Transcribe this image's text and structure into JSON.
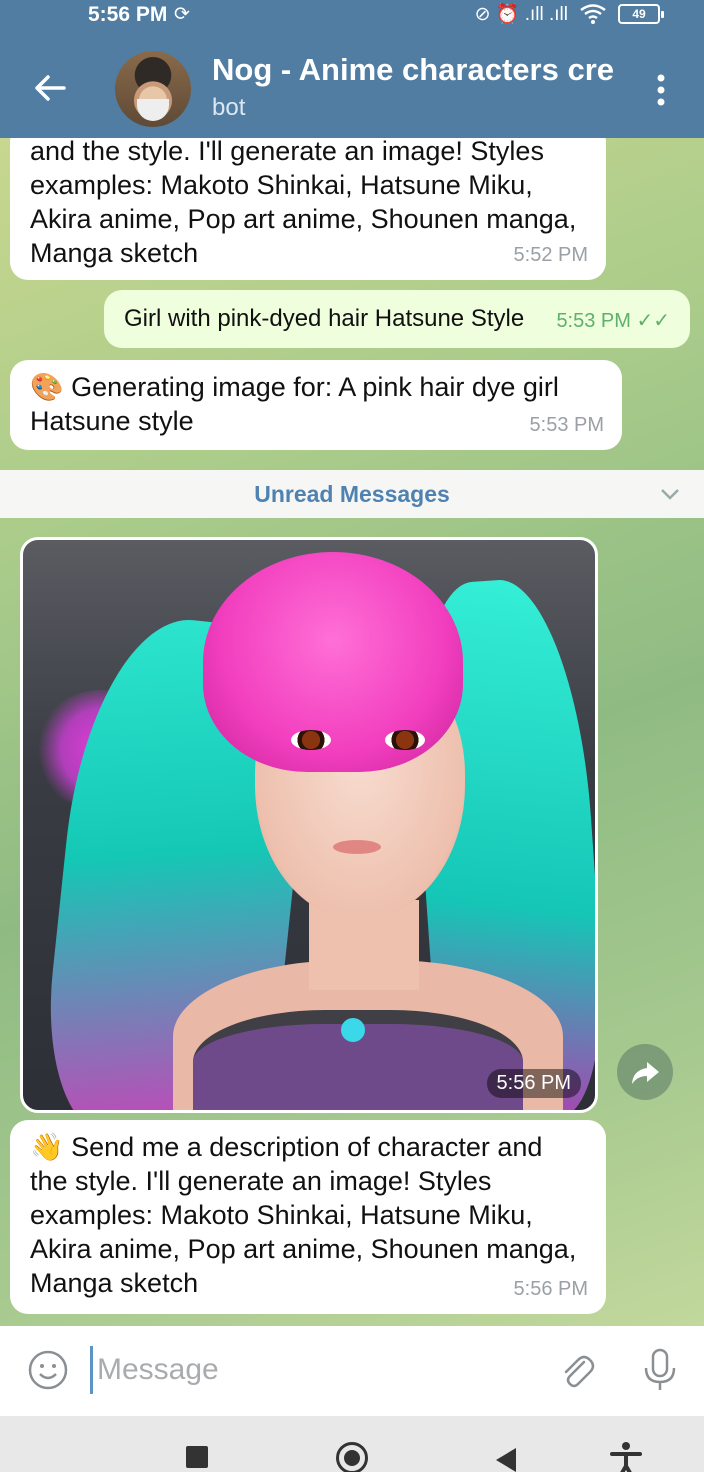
{
  "status_bar": {
    "time": "5:56 PM",
    "right_symbols": "⊘ ⏰ .ıll .ıll",
    "battery": "49"
  },
  "header": {
    "title": "Nog - Anime characters cre",
    "subtitle": "bot"
  },
  "messages": [
    {
      "type": "incoming",
      "text": "and the style. I'll generate an image! Styles examples: Makoto Shinkai, Hatsune Miku, Akira anime, Pop art anime, Shounen manga, Manga sketch",
      "time": "5:52 PM"
    },
    {
      "type": "outgoing",
      "text": "Girl with pink-dyed hair Hatsune Style",
      "time": "5:53 PM",
      "status": "✓✓"
    },
    {
      "type": "incoming",
      "emoji": "🎨",
      "text": "Generating image for: A pink hair dye girl Hatsune style",
      "time": "5:53 PM"
    },
    {
      "type": "incoming",
      "emoji": "👋",
      "text": "Send me a description of character and the style. I'll generate an image! Styles examples: Makoto Shinkai, Hatsune Miku, Akira anime, Pop art anime, Shounen manga, Manga sketch",
      "time": "5:56 PM"
    }
  ],
  "unread_divider": "Unread Messages",
  "image_message": {
    "time": "5:56 PM"
  },
  "input": {
    "placeholder": "Message"
  },
  "colors": {
    "header": "#517da2",
    "outgoing_bubble": "#effedd",
    "accent": "#4f82b0"
  }
}
